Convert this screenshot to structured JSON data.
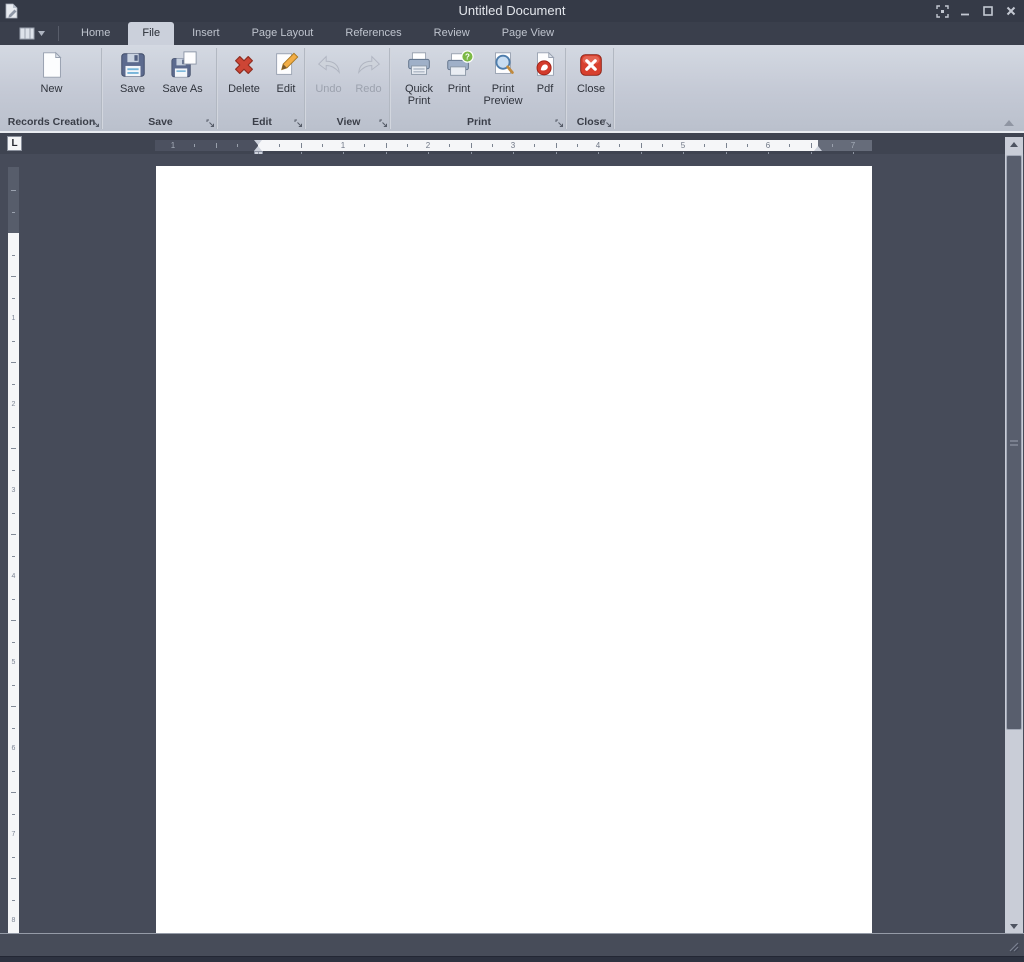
{
  "window": {
    "title": "Untitled Document",
    "controls": [
      {
        "name": "fullscreen"
      },
      {
        "name": "minimize"
      },
      {
        "name": "maximize"
      },
      {
        "name": "close"
      }
    ]
  },
  "tabs": [
    {
      "label": "Home"
    },
    {
      "label": "File",
      "active": true
    },
    {
      "label": "Insert"
    },
    {
      "label": "Page Layout"
    },
    {
      "label": "References"
    },
    {
      "label": "Review"
    },
    {
      "label": "Page View"
    }
  ],
  "ribbon": {
    "groups": [
      {
        "label": "Records Creation",
        "buttons": [
          {
            "label": "New",
            "icon": "new-document-icon"
          }
        ]
      },
      {
        "label": "Save",
        "buttons": [
          {
            "label": "Save",
            "icon": "save-icon"
          },
          {
            "label": "Save As",
            "icon": "save-as-icon"
          }
        ]
      },
      {
        "label": "Edit",
        "buttons": [
          {
            "label": "Delete",
            "icon": "delete-icon"
          },
          {
            "label": "Edit",
            "icon": "edit-icon"
          }
        ]
      },
      {
        "label": "View",
        "buttons": [
          {
            "label": "Undo",
            "icon": "undo-icon",
            "disabled": true
          },
          {
            "label": "Redo",
            "icon": "redo-icon",
            "disabled": true
          }
        ]
      },
      {
        "label": "Print",
        "buttons": [
          {
            "label": "Quick Print",
            "icon": "quick-print-icon"
          },
          {
            "label": "Print",
            "icon": "print-icon"
          },
          {
            "label": "Print Preview",
            "icon": "print-preview-icon"
          },
          {
            "label": "Pdf",
            "icon": "pdf-icon"
          }
        ]
      },
      {
        "label": "Close",
        "buttons": [
          {
            "label": "Close",
            "icon": "close-document-icon"
          }
        ]
      }
    ]
  },
  "ruler": {
    "tab_stop": "L",
    "h_left_numbers": [
      "1"
    ],
    "h_numbers": [
      "1",
      "2",
      "3",
      "4",
      "5",
      "6",
      "7"
    ],
    "v_numbers": [
      "1",
      "2",
      "3",
      "4",
      "5",
      "6",
      "7",
      "8"
    ]
  },
  "colors": {
    "chrome_dark": "#3a3f4c",
    "ribbon_bg": "#c6cbd7",
    "canvas_bg": "#464b59",
    "page_bg": "#ffffff",
    "delete_red": "#cd4535",
    "close_red": "#d8402e",
    "pdf_red": "#d23b2c",
    "print_badge_green": "#7cb945",
    "pencil_orange": "#f2ad45",
    "floppy_blue": "#5c6a8e"
  }
}
